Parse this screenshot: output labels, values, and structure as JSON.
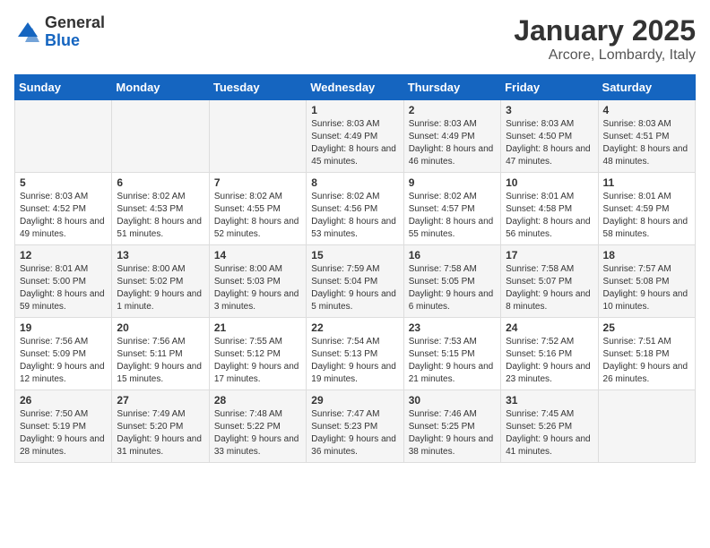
{
  "logo": {
    "general": "General",
    "blue": "Blue"
  },
  "header": {
    "title": "January 2025",
    "subtitle": "Arcore, Lombardy, Italy"
  },
  "weekdays": [
    "Sunday",
    "Monday",
    "Tuesday",
    "Wednesday",
    "Thursday",
    "Friday",
    "Saturday"
  ],
  "weeks": [
    [
      {
        "day": "",
        "sunrise": "",
        "sunset": "",
        "daylight": ""
      },
      {
        "day": "",
        "sunrise": "",
        "sunset": "",
        "daylight": ""
      },
      {
        "day": "",
        "sunrise": "",
        "sunset": "",
        "daylight": ""
      },
      {
        "day": "1",
        "sunrise": "Sunrise: 8:03 AM",
        "sunset": "Sunset: 4:49 PM",
        "daylight": "Daylight: 8 hours and 45 minutes."
      },
      {
        "day": "2",
        "sunrise": "Sunrise: 8:03 AM",
        "sunset": "Sunset: 4:49 PM",
        "daylight": "Daylight: 8 hours and 46 minutes."
      },
      {
        "day": "3",
        "sunrise": "Sunrise: 8:03 AM",
        "sunset": "Sunset: 4:50 PM",
        "daylight": "Daylight: 8 hours and 47 minutes."
      },
      {
        "day": "4",
        "sunrise": "Sunrise: 8:03 AM",
        "sunset": "Sunset: 4:51 PM",
        "daylight": "Daylight: 8 hours and 48 minutes."
      }
    ],
    [
      {
        "day": "5",
        "sunrise": "Sunrise: 8:03 AM",
        "sunset": "Sunset: 4:52 PM",
        "daylight": "Daylight: 8 hours and 49 minutes."
      },
      {
        "day": "6",
        "sunrise": "Sunrise: 8:02 AM",
        "sunset": "Sunset: 4:53 PM",
        "daylight": "Daylight: 8 hours and 51 minutes."
      },
      {
        "day": "7",
        "sunrise": "Sunrise: 8:02 AM",
        "sunset": "Sunset: 4:55 PM",
        "daylight": "Daylight: 8 hours and 52 minutes."
      },
      {
        "day": "8",
        "sunrise": "Sunrise: 8:02 AM",
        "sunset": "Sunset: 4:56 PM",
        "daylight": "Daylight: 8 hours and 53 minutes."
      },
      {
        "day": "9",
        "sunrise": "Sunrise: 8:02 AM",
        "sunset": "Sunset: 4:57 PM",
        "daylight": "Daylight: 8 hours and 55 minutes."
      },
      {
        "day": "10",
        "sunrise": "Sunrise: 8:01 AM",
        "sunset": "Sunset: 4:58 PM",
        "daylight": "Daylight: 8 hours and 56 minutes."
      },
      {
        "day": "11",
        "sunrise": "Sunrise: 8:01 AM",
        "sunset": "Sunset: 4:59 PM",
        "daylight": "Daylight: 8 hours and 58 minutes."
      }
    ],
    [
      {
        "day": "12",
        "sunrise": "Sunrise: 8:01 AM",
        "sunset": "Sunset: 5:00 PM",
        "daylight": "Daylight: 8 hours and 59 minutes."
      },
      {
        "day": "13",
        "sunrise": "Sunrise: 8:00 AM",
        "sunset": "Sunset: 5:02 PM",
        "daylight": "Daylight: 9 hours and 1 minute."
      },
      {
        "day": "14",
        "sunrise": "Sunrise: 8:00 AM",
        "sunset": "Sunset: 5:03 PM",
        "daylight": "Daylight: 9 hours and 3 minutes."
      },
      {
        "day": "15",
        "sunrise": "Sunrise: 7:59 AM",
        "sunset": "Sunset: 5:04 PM",
        "daylight": "Daylight: 9 hours and 5 minutes."
      },
      {
        "day": "16",
        "sunrise": "Sunrise: 7:58 AM",
        "sunset": "Sunset: 5:05 PM",
        "daylight": "Daylight: 9 hours and 6 minutes."
      },
      {
        "day": "17",
        "sunrise": "Sunrise: 7:58 AM",
        "sunset": "Sunset: 5:07 PM",
        "daylight": "Daylight: 9 hours and 8 minutes."
      },
      {
        "day": "18",
        "sunrise": "Sunrise: 7:57 AM",
        "sunset": "Sunset: 5:08 PM",
        "daylight": "Daylight: 9 hours and 10 minutes."
      }
    ],
    [
      {
        "day": "19",
        "sunrise": "Sunrise: 7:56 AM",
        "sunset": "Sunset: 5:09 PM",
        "daylight": "Daylight: 9 hours and 12 minutes."
      },
      {
        "day": "20",
        "sunrise": "Sunrise: 7:56 AM",
        "sunset": "Sunset: 5:11 PM",
        "daylight": "Daylight: 9 hours and 15 minutes."
      },
      {
        "day": "21",
        "sunrise": "Sunrise: 7:55 AM",
        "sunset": "Sunset: 5:12 PM",
        "daylight": "Daylight: 9 hours and 17 minutes."
      },
      {
        "day": "22",
        "sunrise": "Sunrise: 7:54 AM",
        "sunset": "Sunset: 5:13 PM",
        "daylight": "Daylight: 9 hours and 19 minutes."
      },
      {
        "day": "23",
        "sunrise": "Sunrise: 7:53 AM",
        "sunset": "Sunset: 5:15 PM",
        "daylight": "Daylight: 9 hours and 21 minutes."
      },
      {
        "day": "24",
        "sunrise": "Sunrise: 7:52 AM",
        "sunset": "Sunset: 5:16 PM",
        "daylight": "Daylight: 9 hours and 23 minutes."
      },
      {
        "day": "25",
        "sunrise": "Sunrise: 7:51 AM",
        "sunset": "Sunset: 5:18 PM",
        "daylight": "Daylight: 9 hours and 26 minutes."
      }
    ],
    [
      {
        "day": "26",
        "sunrise": "Sunrise: 7:50 AM",
        "sunset": "Sunset: 5:19 PM",
        "daylight": "Daylight: 9 hours and 28 minutes."
      },
      {
        "day": "27",
        "sunrise": "Sunrise: 7:49 AM",
        "sunset": "Sunset: 5:20 PM",
        "daylight": "Daylight: 9 hours and 31 minutes."
      },
      {
        "day": "28",
        "sunrise": "Sunrise: 7:48 AM",
        "sunset": "Sunset: 5:22 PM",
        "daylight": "Daylight: 9 hours and 33 minutes."
      },
      {
        "day": "29",
        "sunrise": "Sunrise: 7:47 AM",
        "sunset": "Sunset: 5:23 PM",
        "daylight": "Daylight: 9 hours and 36 minutes."
      },
      {
        "day": "30",
        "sunrise": "Sunrise: 7:46 AM",
        "sunset": "Sunset: 5:25 PM",
        "daylight": "Daylight: 9 hours and 38 minutes."
      },
      {
        "day": "31",
        "sunrise": "Sunrise: 7:45 AM",
        "sunset": "Sunset: 5:26 PM",
        "daylight": "Daylight: 9 hours and 41 minutes."
      },
      {
        "day": "",
        "sunrise": "",
        "sunset": "",
        "daylight": ""
      }
    ]
  ]
}
